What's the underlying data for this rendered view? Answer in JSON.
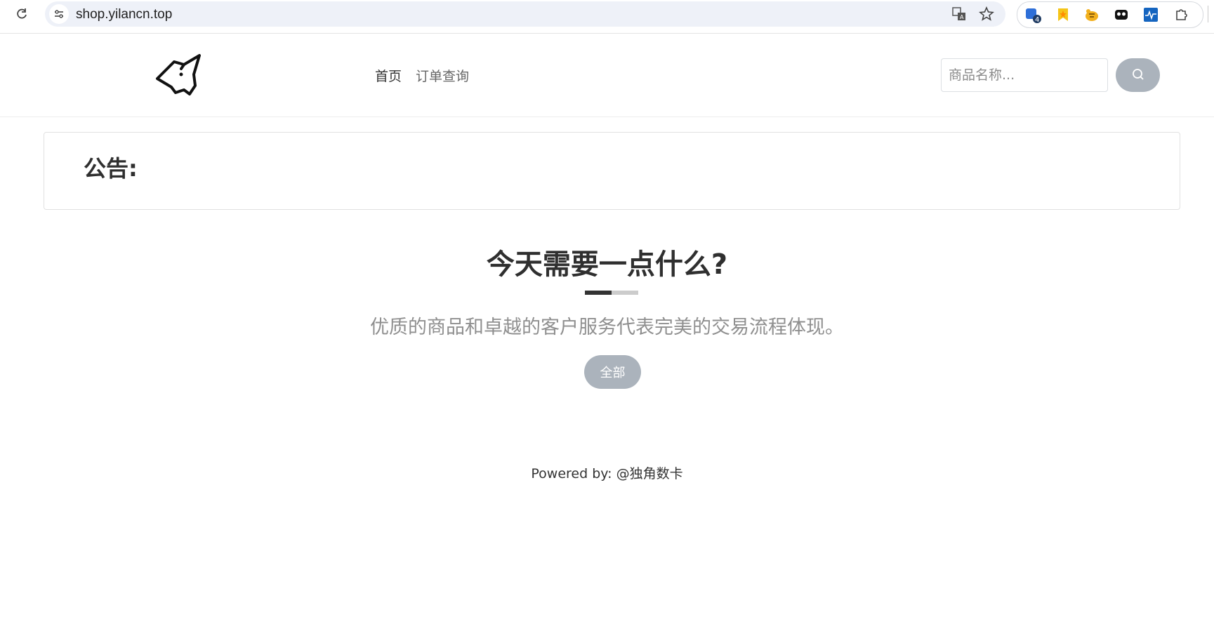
{
  "browser": {
    "url": "shop.yilancn.top",
    "extensions": [
      {
        "icon": "shield-extension-icon",
        "badge": "4"
      },
      {
        "icon": "bookmark-extension-icon"
      },
      {
        "icon": "tiger-extension-icon"
      },
      {
        "icon": "mask-extension-icon"
      },
      {
        "icon": "pulse-extension-icon"
      },
      {
        "icon": "puzzle-extensions-icon"
      }
    ]
  },
  "header": {
    "logo_icon": "unicorn-logo-icon",
    "nav": [
      {
        "label": "首页"
      },
      {
        "label": "订单查询"
      }
    ],
    "search": {
      "placeholder": "商品名称..."
    }
  },
  "notice": {
    "title": "公告:"
  },
  "hero": {
    "title": "今天需要一点什么?",
    "subtitle": "优质的商品和卓越的客户服务代表完美的交易流程体现。",
    "filter_all_label": "全部"
  },
  "footer": {
    "powered_by": "Powered by: @独角数卡"
  },
  "colors": {
    "button_gray": "#abb3bc",
    "text_dark": "#2f2f2f",
    "text_muted": "#8f8f8f"
  }
}
